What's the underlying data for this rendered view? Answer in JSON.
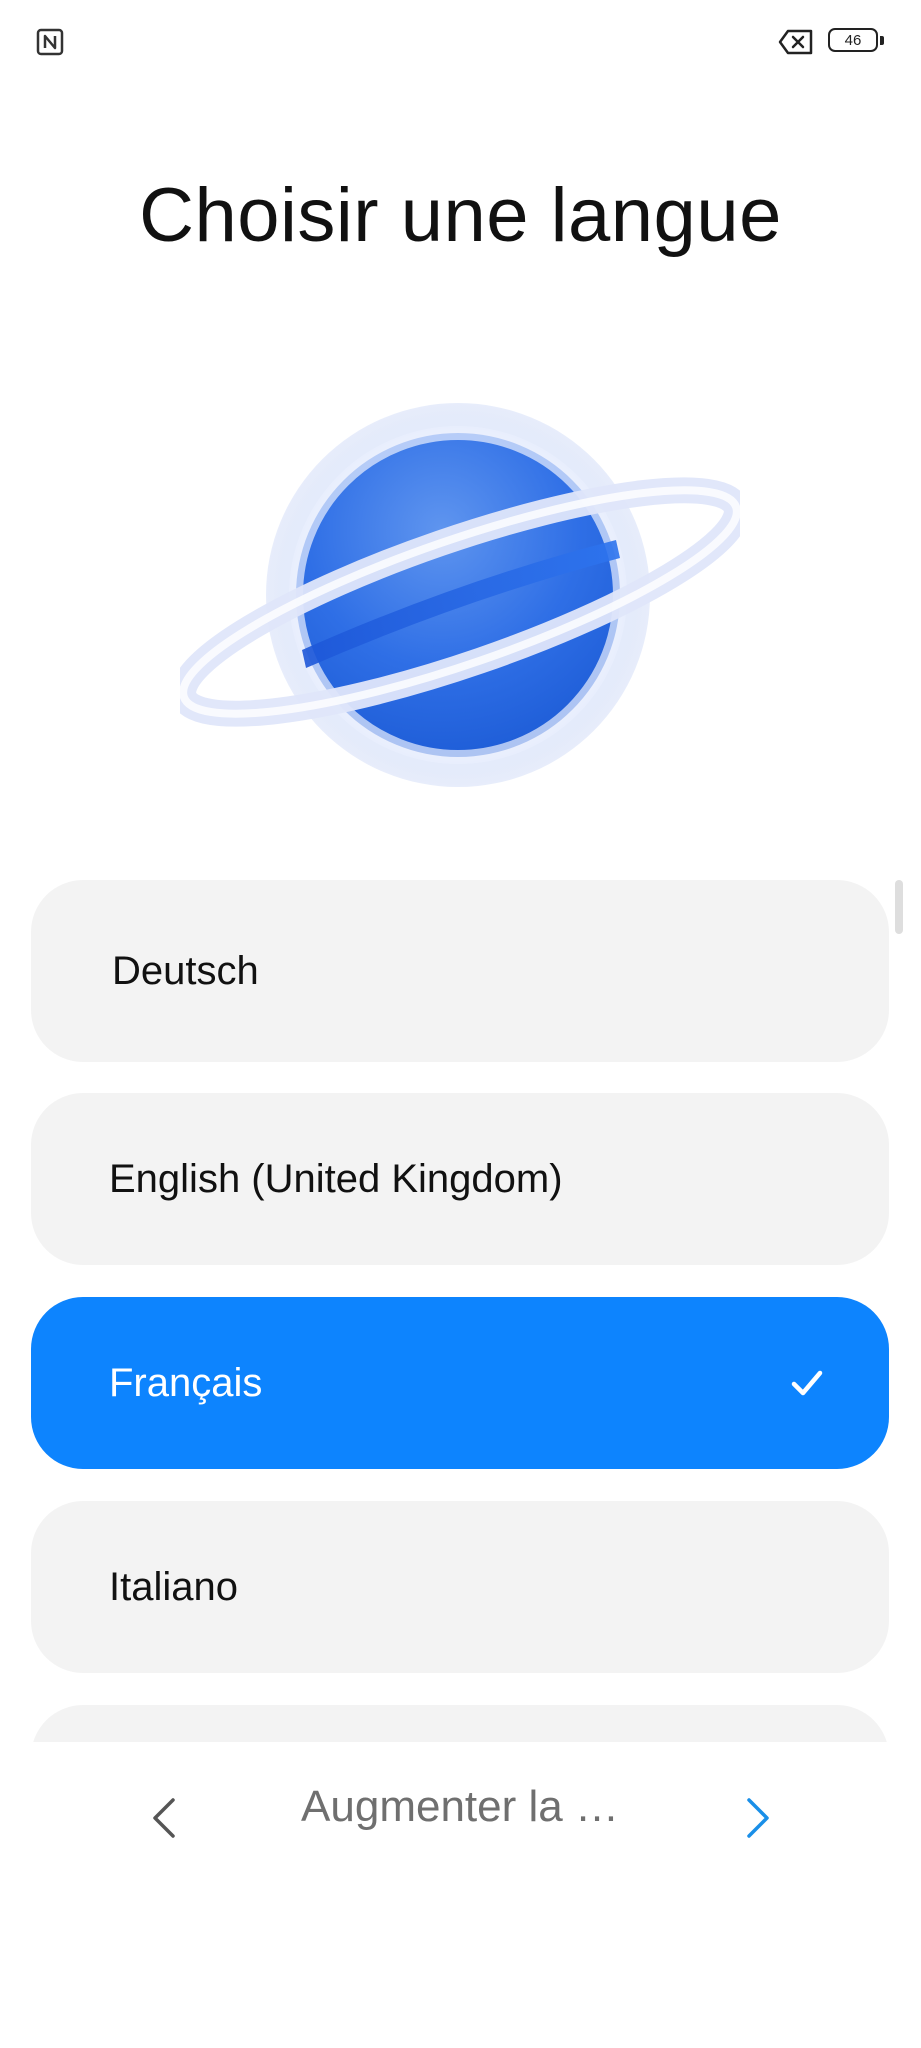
{
  "status_bar": {
    "left_icon": "nfc-icon",
    "sim_icon": "no-sim-icon",
    "battery_level": "46"
  },
  "title": "Choisir une langue",
  "illustration": "planet-illustration",
  "languages": [
    {
      "label": "Deutsch",
      "selected": false
    },
    {
      "label": "English (United Kingdom)",
      "selected": false
    },
    {
      "label": "Français",
      "selected": true
    },
    {
      "label": "Italiano",
      "selected": false
    }
  ],
  "bottom_nav": {
    "back_icon": "chevron-left-icon",
    "center_label": "Augmenter la …",
    "next_icon": "chevron-right-icon"
  },
  "colors": {
    "accent": "#0d84fe",
    "item_background": "#f3f3f3",
    "next_arrow": "#1a8fe8",
    "back_arrow": "#555555"
  }
}
